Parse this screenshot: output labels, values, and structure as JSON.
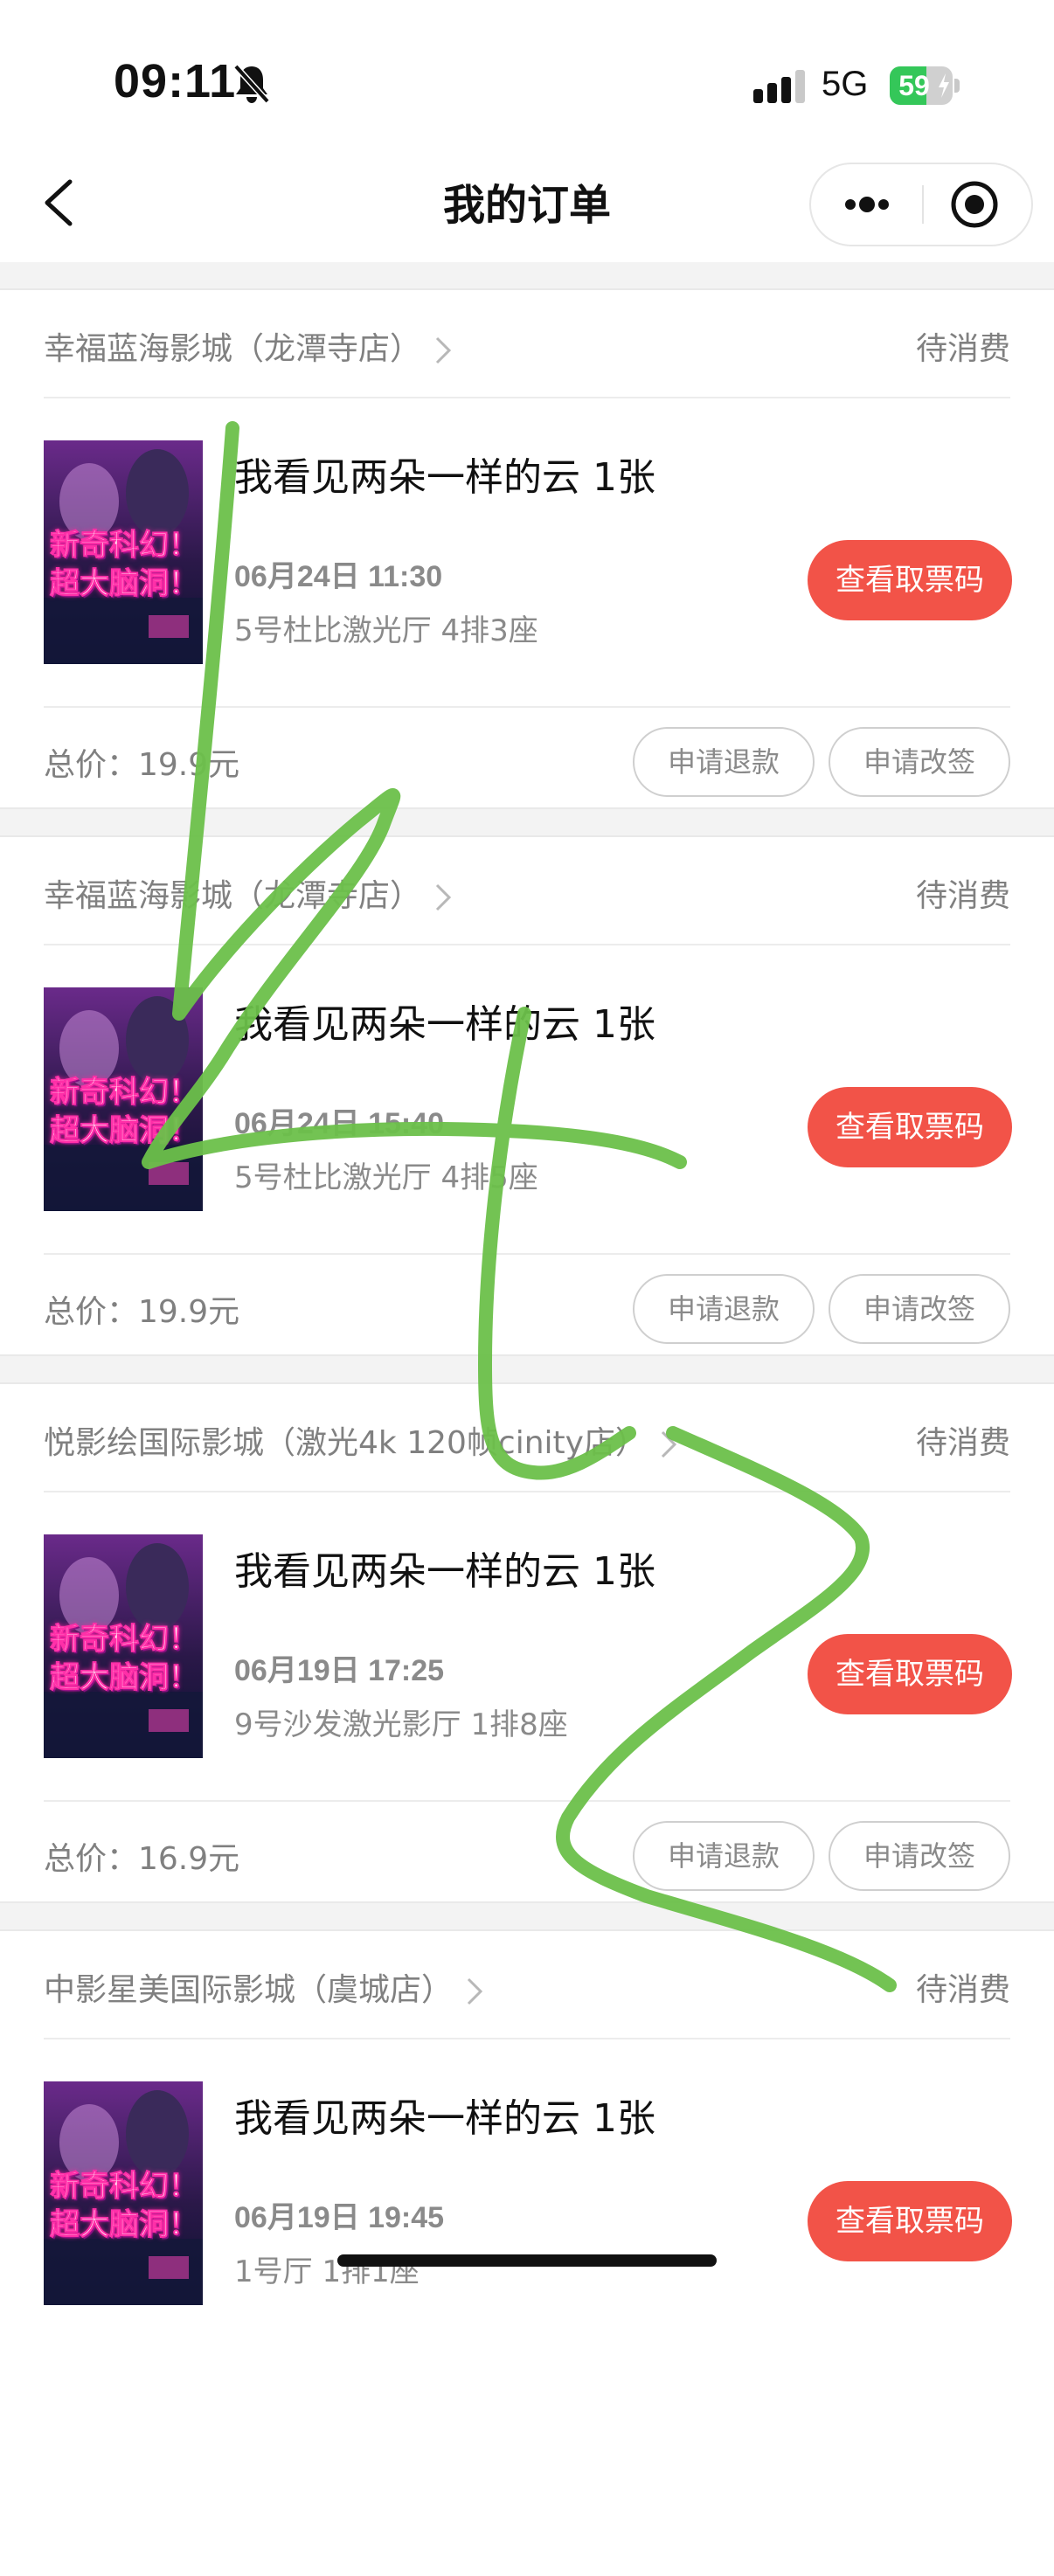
{
  "status_bar": {
    "time": "09:11",
    "silent_icon": "bell-slash-icon",
    "signal_icon": "cellular-signal-icon",
    "network": "5G",
    "battery_percent": 59,
    "battery_text": "59",
    "battery_color": "#34c759"
  },
  "header": {
    "back_icon": "chevron-left-icon",
    "title": "我的订单",
    "more_icon": "more-dots-icon",
    "close_icon": "target-circle-icon"
  },
  "colors": {
    "accent": "#f25348",
    "annotation_stroke": "#6cc04a"
  },
  "poster_text": "新奇科幻！超大脑洞！",
  "orders": [
    {
      "cinema": "幸福蓝海影城（龙潭寺店）",
      "status": "待消费",
      "movie_title": "我看见两朵一样的云 1张",
      "showtime": "06月24日 11:30",
      "seat": "5号杜比激光厅 4排3座",
      "ticket_button": "查看取票码",
      "total": "总价：19.9元",
      "refund_button": "申请退款",
      "change_button": "申请改签"
    },
    {
      "cinema": "幸福蓝海影城（龙潭寺店）",
      "status": "待消费",
      "movie_title": "我看见两朵一样的云 1张",
      "showtime": "06月24日 15:40",
      "seat": "5号杜比激光厅 4排5座",
      "ticket_button": "查看取票码",
      "total": "总价：19.9元",
      "refund_button": "申请退款",
      "change_button": "申请改签"
    },
    {
      "cinema": "悦影绘国际影城（激光4k 120帧cinity店）",
      "status": "待消费",
      "movie_title": "我看见两朵一样的云 1张",
      "showtime": "06月19日 17:25",
      "seat": "9号沙发激光影厅 1排8座",
      "ticket_button": "查看取票码",
      "total": "总价：16.9元",
      "refund_button": "申请退款",
      "change_button": "申请改签"
    },
    {
      "cinema": "中影星美国际影城（虞城店）",
      "status": "待消费",
      "movie_title": "我看见两朵一样的云 1张",
      "showtime": "06月19日 19:45",
      "seat": "1号厅 1排1座",
      "ticket_button": "查看取票码"
    }
  ]
}
